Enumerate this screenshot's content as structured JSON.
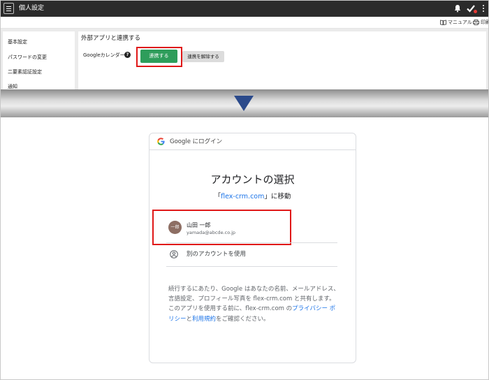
{
  "app": {
    "title": "個人設定"
  },
  "toolbar": {
    "manual_label": "マニュアル",
    "print_label": "印刷"
  },
  "sidebar": {
    "items": [
      {
        "label": "基本設定"
      },
      {
        "label": "パスワードの変更"
      },
      {
        "label": "二要素認証設定"
      },
      {
        "label": "通知"
      }
    ]
  },
  "external": {
    "section_title": "外部アプリと連携する",
    "google_calendar_label": "Googleカレンダー",
    "help_symbol": "?",
    "connect_label": "連携する",
    "disconnect_label": "連携を解除する"
  },
  "google_login": {
    "header": "Google にログイン",
    "title": "アカウントの選択",
    "continue_prefix": "「",
    "continue_domain": "flex-crm.com",
    "continue_suffix": "」に移動",
    "account": {
      "avatar_text": "一郎",
      "name": "山田 一郎",
      "email": "yamada@abcde.co.jp"
    },
    "use_other_account": "別のアカウントを使用",
    "disclaimer": {
      "part1": "続行するにあたり、Google はあなたの名前、メールアドレス、言語設定、プロフィール写真を flex-crm.com と共有します。 このアプリを使用する前に、flex-crm.com の",
      "privacy_link": "プライバシー ポリシー",
      "part2": "と",
      "terms_link": "利用規約",
      "part3": "をご確認ください。"
    }
  },
  "colors": {
    "appbar": "#2b2b2b",
    "connect_button": "#2e9d5b",
    "highlight": "#e01818",
    "google_link": "#1a73e8",
    "arrow": "#2b4a8b",
    "avatar": "#8d6e63"
  }
}
